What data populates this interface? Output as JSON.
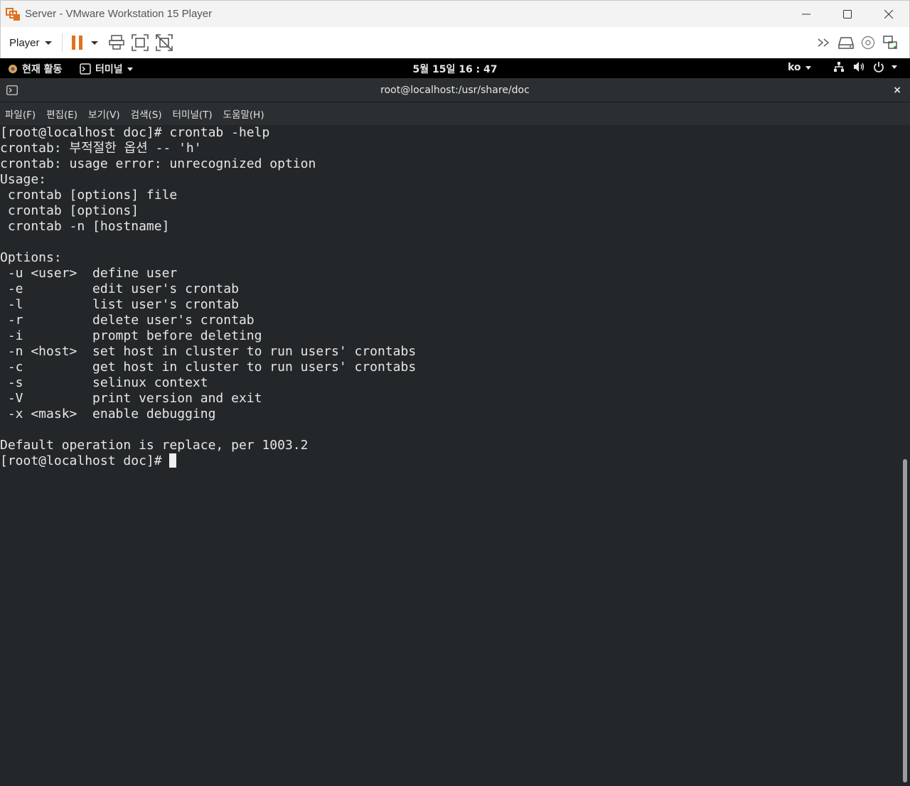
{
  "window": {
    "title": "Server - VMware Workstation 15 Player",
    "minimize_icon": "minimize-icon",
    "maximize_icon": "maximize-icon",
    "close_icon": "close-icon"
  },
  "toolbar": {
    "player_label": "Player",
    "accent": "#e0721d"
  },
  "gnome": {
    "activities": "현재 활동",
    "app_menu": "터미널",
    "clock": "5월 15일  16 : 47",
    "lang": "ko"
  },
  "terminal": {
    "title": "root@localhost:/usr/share/doc",
    "close": "×",
    "menu": [
      "파일(F)",
      "편집(E)",
      "보기(V)",
      "검색(S)",
      "터미널(T)",
      "도움말(H)"
    ],
    "lines": [
      "[root@localhost doc]# crontab -help",
      "crontab: 부적절한 옵션 -- 'h'",
      "crontab: usage error: unrecognized option",
      "Usage:",
      " crontab [options] file",
      " crontab [options]",
      " crontab -n [hostname]",
      "",
      "Options:",
      " -u <user>  define user",
      " -e         edit user's crontab",
      " -l         list user's crontab",
      " -r         delete user's crontab",
      " -i         prompt before deleting",
      " -n <host>  set host in cluster to run users' crontabs",
      " -c         get host in cluster to run users' crontabs",
      " -s         selinux context",
      " -V         print version and exit",
      " -x <mask>  enable debugging",
      "",
      "Default operation is replace, per 1003.2"
    ],
    "prompt": "[root@localhost doc]# "
  }
}
